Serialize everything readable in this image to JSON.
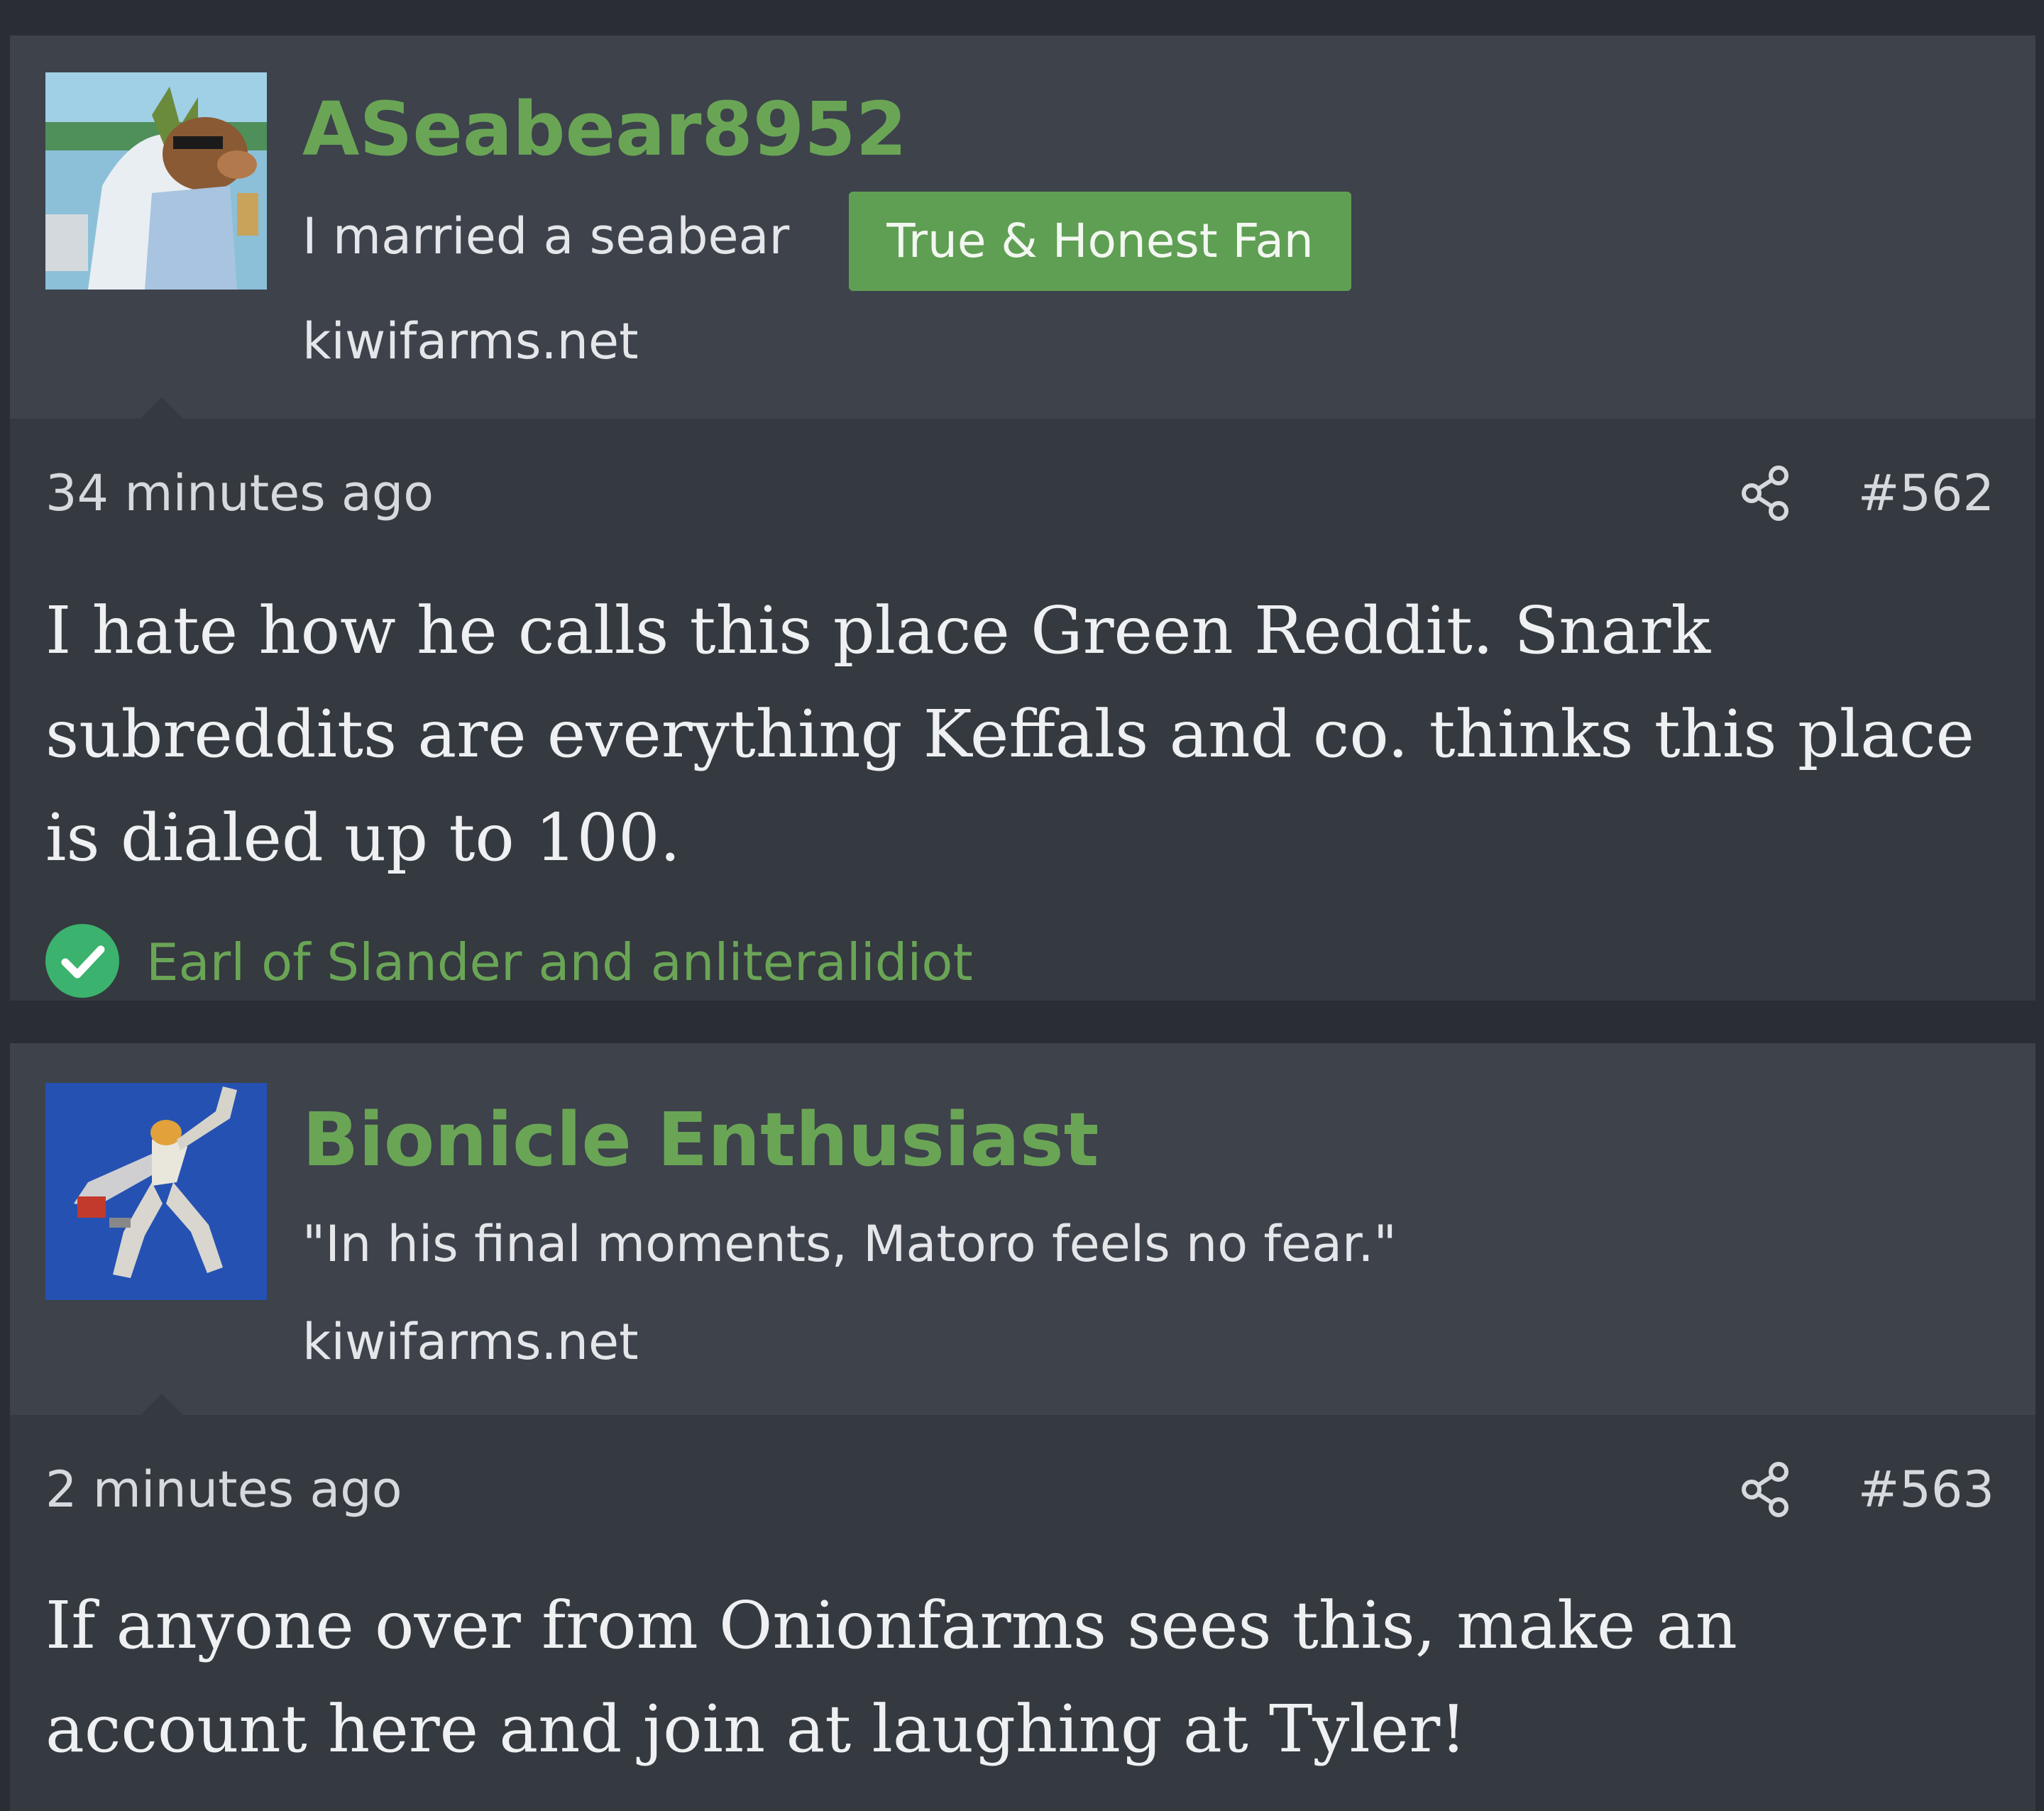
{
  "colors": {
    "page_background": "#2a2d33",
    "post_background": "#353940",
    "header_background": "#3d424b",
    "username_green": "#6aa556",
    "banner_green": "#5f9f53",
    "text_light": "#eef0f2"
  },
  "posts": [
    {
      "author": {
        "username": "ASeabear8952",
        "custom_title": "I married a seabear",
        "banner": "True & Honest Fan",
        "site": "kiwifarms.net",
        "avatar_icon": "seabear-avatar"
      },
      "date": "34 minutes ago",
      "share_icon": "share-icon",
      "number": "#562",
      "body": "I hate how he calls this place Green Reddit. Snark subreddits are everything Keffals and co. thinks this place is dialed up to 100.",
      "reactions": {
        "icon": "checkmark-icon",
        "users": "Earl of Slander and anliteralidiot"
      }
    },
    {
      "author": {
        "username": "Bionicle Enthusiast",
        "custom_title": "\"In his final moments, Matoro feels no fear.\"",
        "site": "kiwifarms.net",
        "avatar_icon": "bionicle-avatar"
      },
      "date": "2 minutes ago",
      "share_icon": "share-icon",
      "number": "#563",
      "body": "If anyone over from Onionfarms sees this, make an account here and join at laughing at Tyler!"
    }
  ]
}
